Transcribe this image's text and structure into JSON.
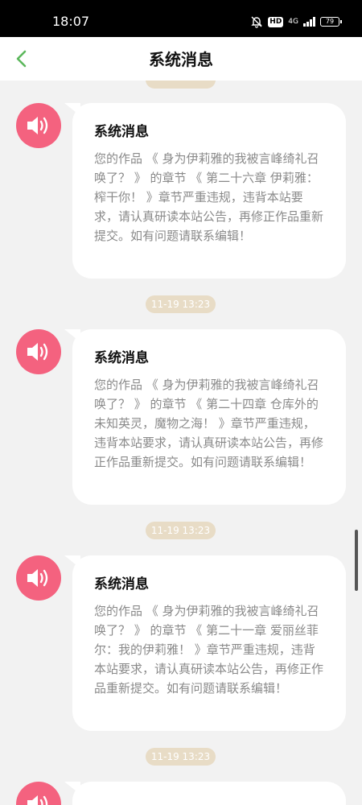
{
  "status_bar": {
    "time": "18:07",
    "hd_label": "HD",
    "network_label": "4G",
    "battery_level": "79"
  },
  "header": {
    "title": "系统消息",
    "back_icon": "chevron-left-icon",
    "accent_color": "#5cb85c"
  },
  "messages": [
    {
      "title": "系统消息",
      "body": "您的作品 《 身为伊莉雅的我被言峰绮礼召唤了？ 》 的章节 《 第二十六章 伊莉雅：榨干你！ 》章节严重违规，违背本站要求，请认真研读本站公告，再修正作品重新提交。如有问题请联系编辑！"
    },
    {
      "timestamp": "11-19 13:23",
      "title": "系统消息",
      "body": "您的作品 《 身为伊莉雅的我被言峰绮礼召唤了？ 》 的章节 《 第二十四章 仓库外的未知英灵，魔物之海！ 》章节严重违规，违背本站要求，请认真研读本站公告，再修正作品重新提交。如有问题请联系编辑！"
    },
    {
      "timestamp": "11-19 13:23",
      "title": "系统消息",
      "body": "您的作品 《 身为伊莉雅的我被言峰绮礼召唤了？ 》 的章节 《 第二十一章 爱丽丝菲尔：我的伊莉雅！ 》章节严重违规，违背本站要求，请认真研读本站公告，再修正作品重新提交。如有问题请联系编辑！"
    },
    {
      "timestamp": "11-19 13:23"
    }
  ],
  "colors": {
    "avatar": "#f4627f",
    "timestamp_pill": "#e8dcc6",
    "body_text": "#8a8a8a"
  },
  "icons": {
    "avatar": "speaker-icon"
  }
}
